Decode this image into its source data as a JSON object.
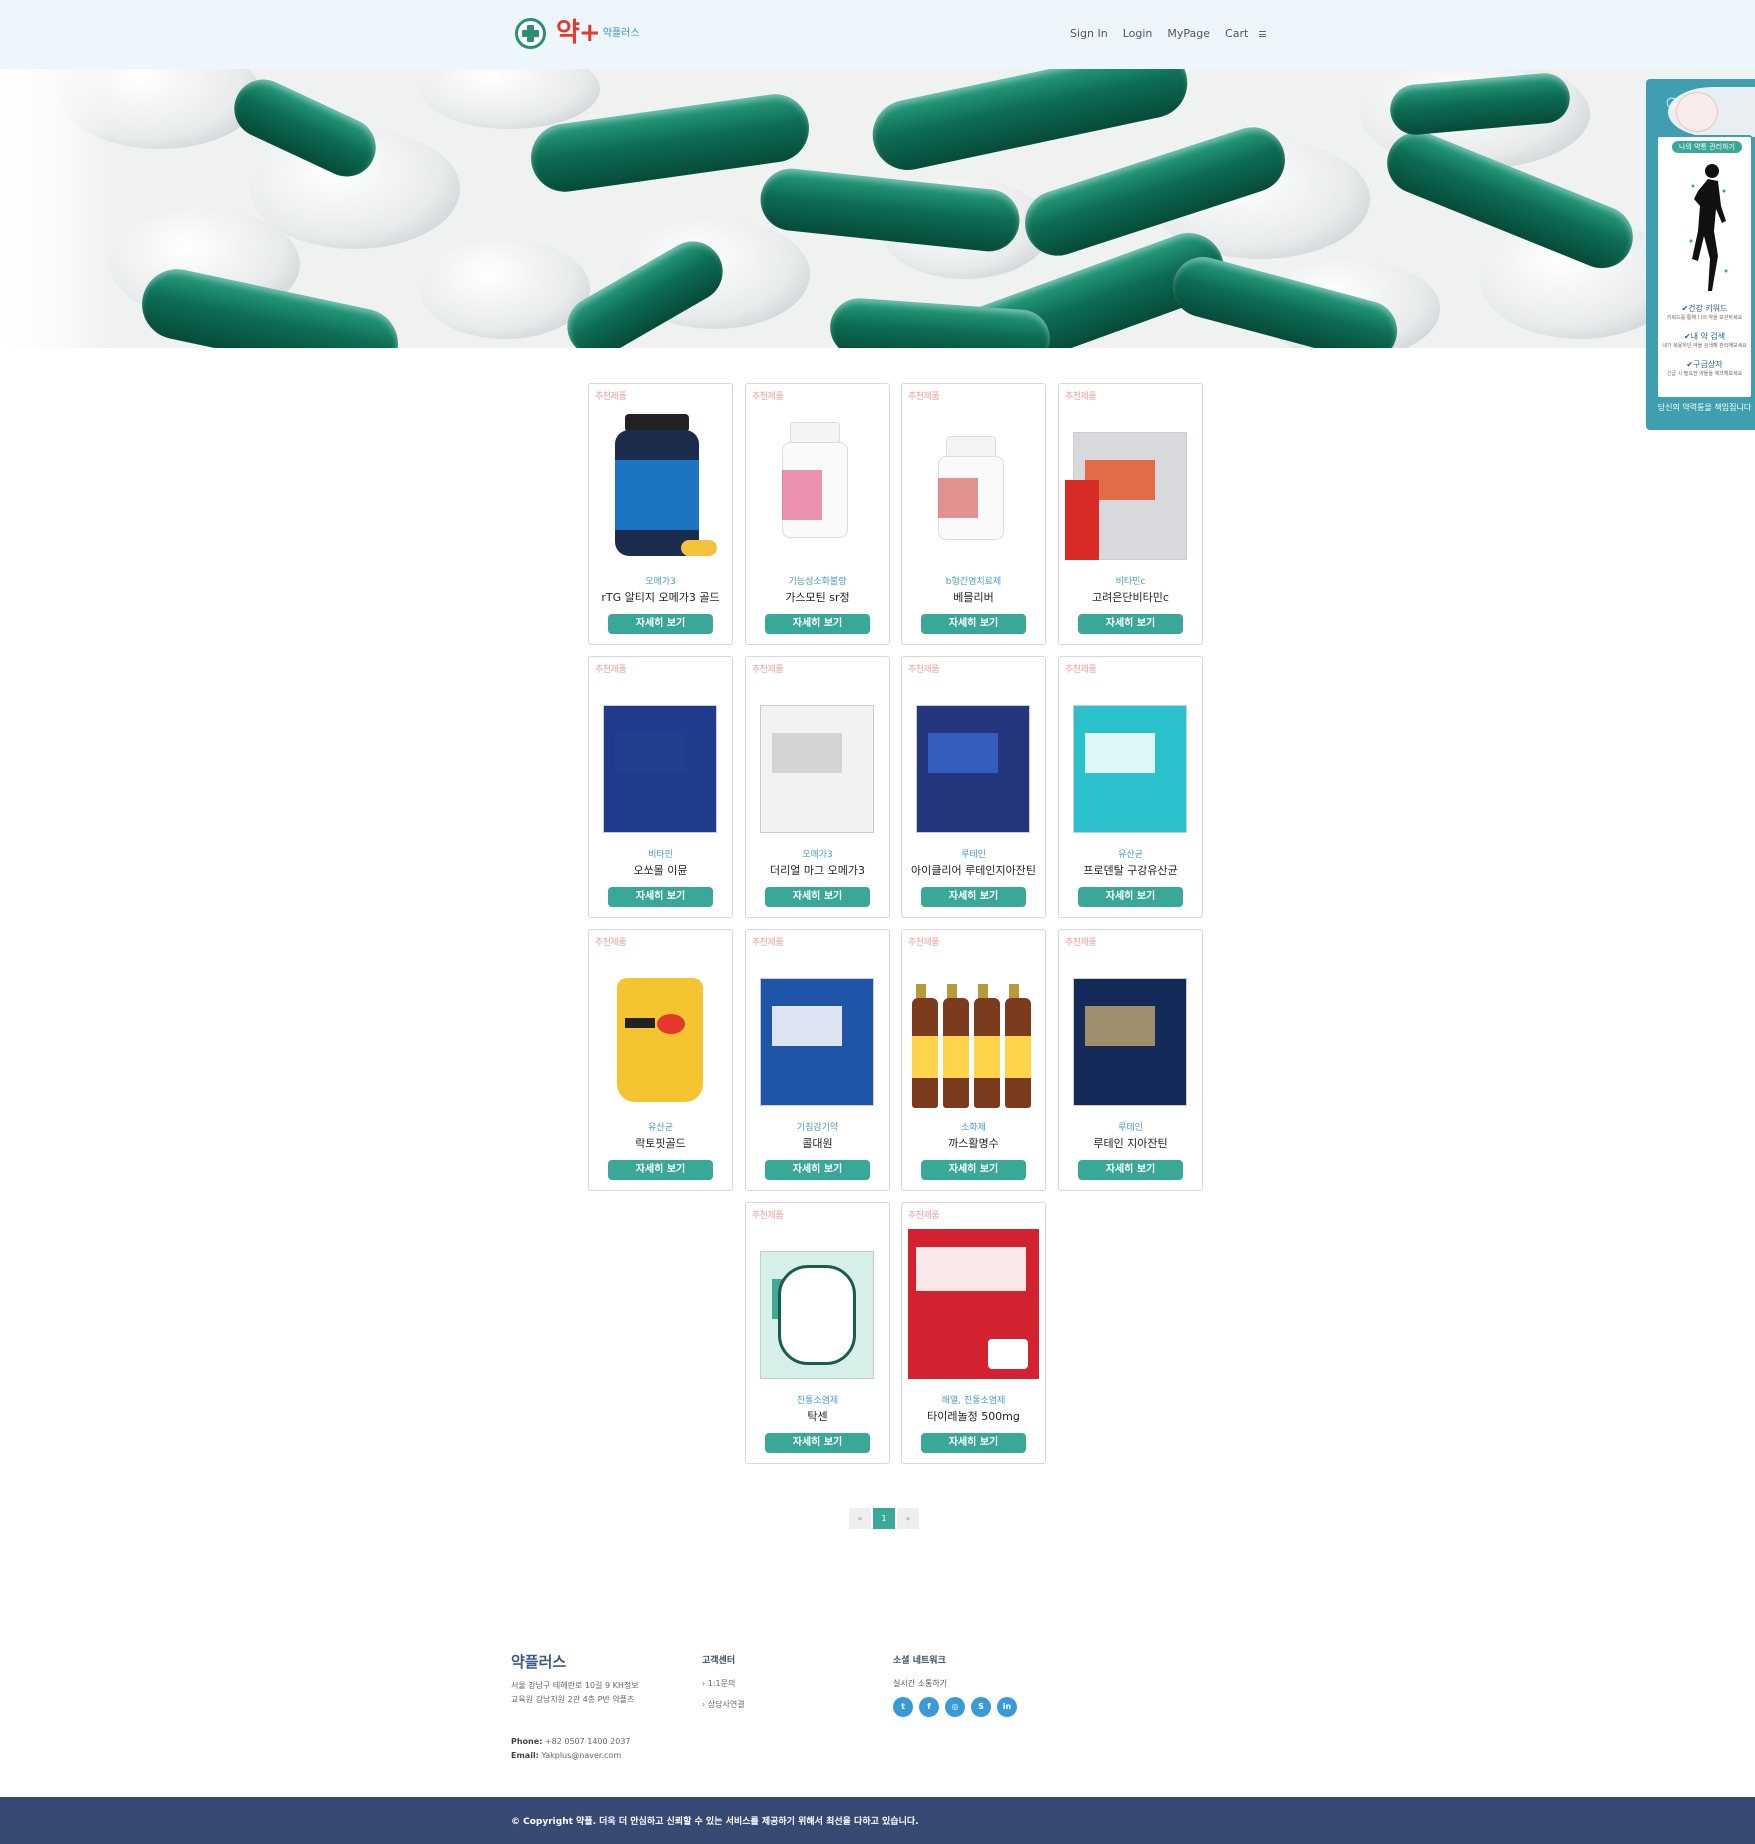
{
  "header": {
    "logo_text": "약+",
    "logo_sub": "약플러스",
    "nav": [
      "Sign In",
      "Login",
      "MyPage",
      "Cart"
    ]
  },
  "side_widget": {
    "title": "나의 약통 관리하기",
    "features": [
      {
        "title": "건강 키워드",
        "desc": "키워드를 통해 나의 약을 보관하세요"
      },
      {
        "title": "내 약 검색",
        "desc": "내가 복용하던 약을 검색해 관리해보세요"
      },
      {
        "title": "구급상자",
        "desc": "긴급 시 필요한 약들을 체크해보세요"
      }
    ],
    "bottom": "당신의 약력통을 책임집니다"
  },
  "products": [
    {
      "tag": "추천제품",
      "category": "오메가3",
      "name": "rTG 알티지 오메가3 골드",
      "button": "자세히 보기"
    },
    {
      "tag": "추천제품",
      "category": "기능성소화불량",
      "name": "가스모틴 sr정",
      "button": "자세히 보기"
    },
    {
      "tag": "추천제품",
      "category": "b형간염치료제",
      "name": "베믈리버",
      "button": "자세히 보기"
    },
    {
      "tag": "추천제품",
      "category": "비타민c",
      "name": "고려은단비타민c",
      "button": "자세히 보기"
    },
    {
      "tag": "추천제품",
      "category": "비타민",
      "name": "오쏘몰 이뮨",
      "button": "자세히 보기"
    },
    {
      "tag": "추천제품",
      "category": "오메가3",
      "name": "더리얼 마그 오메가3",
      "button": "자세히 보기"
    },
    {
      "tag": "추천제품",
      "category": "루테인",
      "name": "아이클리어 루테인지아잔틴",
      "button": "자세히 보기"
    },
    {
      "tag": "추천제품",
      "category": "유산균",
      "name": "프로덴탈 구강유산균",
      "button": "자세히 보기"
    },
    {
      "tag": "추천제품",
      "category": "유산균",
      "name": "락토핏골드",
      "button": "자세히 보기"
    },
    {
      "tag": "추천제품",
      "category": "기침감기약",
      "name": "콜대원",
      "button": "자세히 보기"
    },
    {
      "tag": "추천제품",
      "category": "소화제",
      "name": "까스활명수",
      "button": "자세히 보기"
    },
    {
      "tag": "추천제품",
      "category": "루테인",
      "name": "루테인 지아잔틴",
      "button": "자세히 보기"
    },
    {
      "tag": "추천제품",
      "category": "진통소염제",
      "name": "탁센",
      "button": "자세히 보기"
    },
    {
      "tag": "추천제품",
      "category": "해열, 진통소염제",
      "name": "타이레놀정 500mg",
      "button": "자세히 보기"
    }
  ],
  "pagination": {
    "prev": "«",
    "current": "1",
    "next": "»"
  },
  "footer": {
    "brand": "약플러스",
    "address": "서울 강남구 테헤란로 10길 9 KH정보교육원 강남지원 2관 4층 P반 약플즈",
    "phone_label": "Phone:",
    "phone": "+82 0507 1400 2037",
    "email_label": "Email:",
    "email": "Yakplus@naver.com",
    "cs_title": "고객센터",
    "cs_links": [
      "1:1문의",
      "상담사연결"
    ],
    "social_title": "소셜 네트워크",
    "social_sub": "실시간 소통하기",
    "socials": [
      "twitter-icon",
      "facebook-icon",
      "instagram-icon",
      "skype-icon",
      "linkedin-icon"
    ],
    "copyright": "© Copyright 약플. 더욱 더 안심하고 신뢰할 수 있는 서비스를 제공하기 위해서 최선을 다하고 있습니다."
  },
  "colors": {
    "accent": "#3aa896",
    "header_bg": "#eef6fd",
    "footer_bar": "#364a73",
    "logo_red": "#e23b2e"
  }
}
